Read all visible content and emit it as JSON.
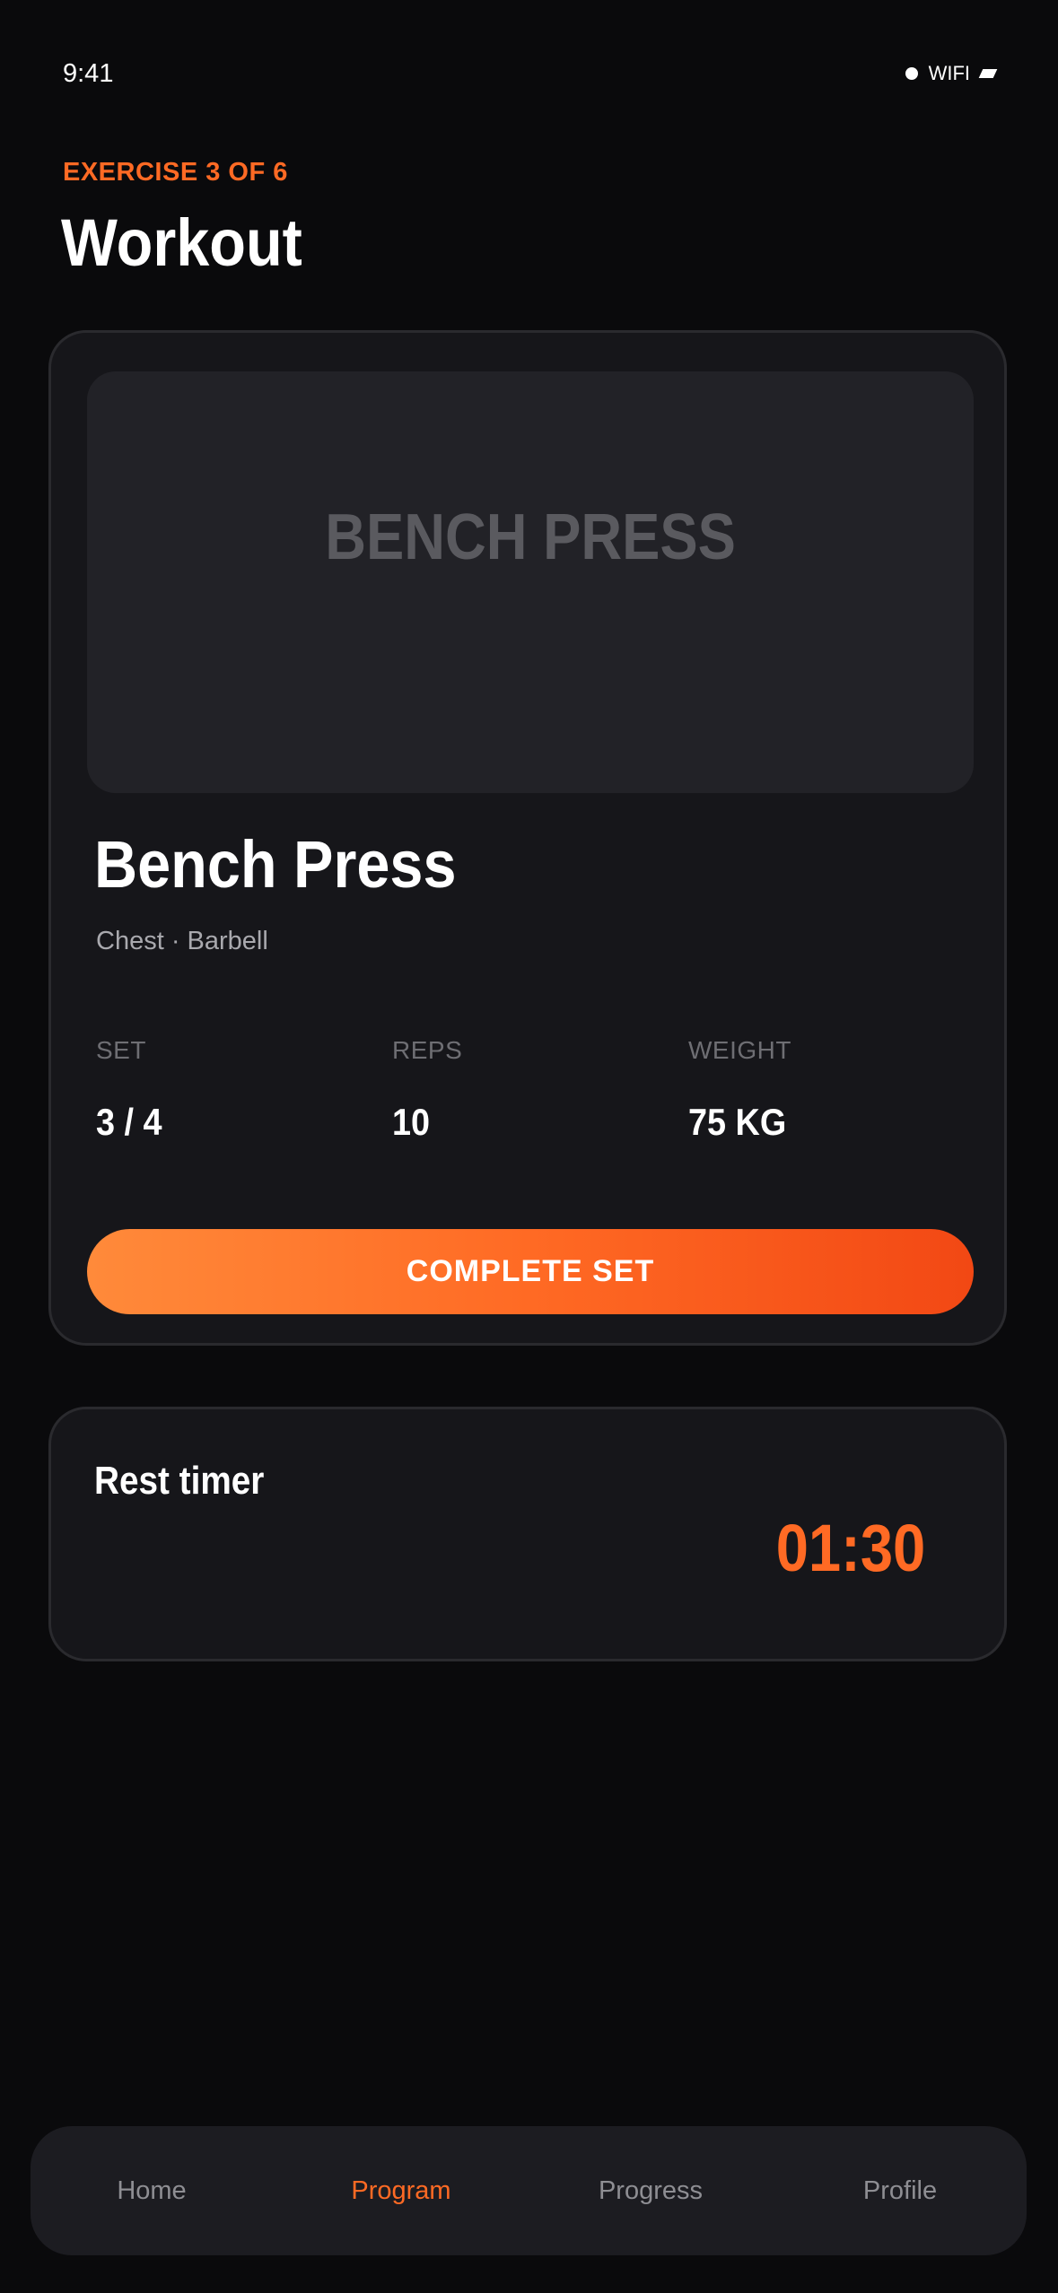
{
  "status_bar": {
    "time": "9:41",
    "wifi_label": "WIFI",
    "icons": [
      "signal-dot-icon",
      "battery-icon"
    ]
  },
  "header": {
    "eyebrow": "EXERCISE 3 OF 6",
    "title": "Workout"
  },
  "exercise": {
    "image_text": "BENCH PRESS",
    "name": "Bench Press",
    "meta": "Chest · Barbell",
    "stats": [
      {
        "label": "SET",
        "value": "3 / 4"
      },
      {
        "label": "REPS",
        "value": "10"
      },
      {
        "label": "WEIGHT",
        "value": "75 KG"
      }
    ],
    "complete_button_label": "COMPLETE SET"
  },
  "rest_timer": {
    "title": "Rest timer",
    "value": "01:30"
  },
  "tab_bar": {
    "items": [
      {
        "label": "Home",
        "active": false
      },
      {
        "label": "Program",
        "active": true
      },
      {
        "label": "Progress",
        "active": false
      },
      {
        "label": "Profile",
        "active": false
      }
    ]
  },
  "colors": {
    "accent": "#ff6a24",
    "background": "#0a0a0c",
    "card": "#16161a",
    "muted_text": "#8e8e93"
  }
}
